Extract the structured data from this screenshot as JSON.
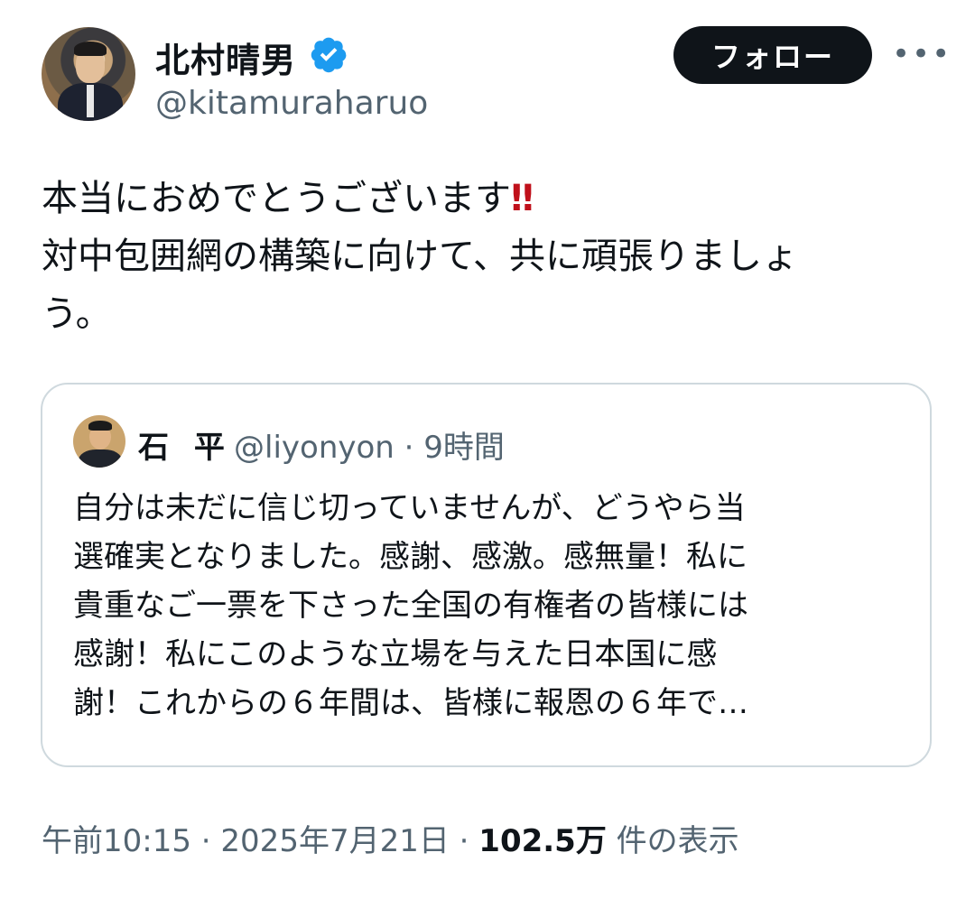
{
  "author": {
    "name": "北村晴男",
    "handle": "@kitamuraharuo",
    "verified": true
  },
  "follow_label": "フォロー",
  "more_label": "•••",
  "tweet": {
    "line1": "本当におめでとうございます",
    "emoji": "‼",
    "line2": "対中包囲網の構築に向けて、共に頑張りましょ",
    "line3": "う。"
  },
  "quoted": {
    "name": "石 平",
    "handle": "@liyonyon",
    "time": "9時間",
    "text_lines": [
      "自分は未だに信じ切っていませんが、どうやら当",
      "選確実となりました。感謝、感激。感無量！私に",
      "貴重なご一票を下さった全国の有権者の皆様には",
      "感謝！私にこのような立場を与えた日本国に感",
      "謝！これからの６年間は、皆様に報恩の６年で…"
    ]
  },
  "meta": {
    "time": "午前10:15",
    "date": "2025年7月21日",
    "views": "102.5万",
    "views_label": "件の表示"
  },
  "colors": {
    "text": "#0f1419",
    "secondary": "#536471",
    "verified": "#1d9bf0",
    "border": "#cfd9de",
    "emoji": "#c0111b"
  }
}
